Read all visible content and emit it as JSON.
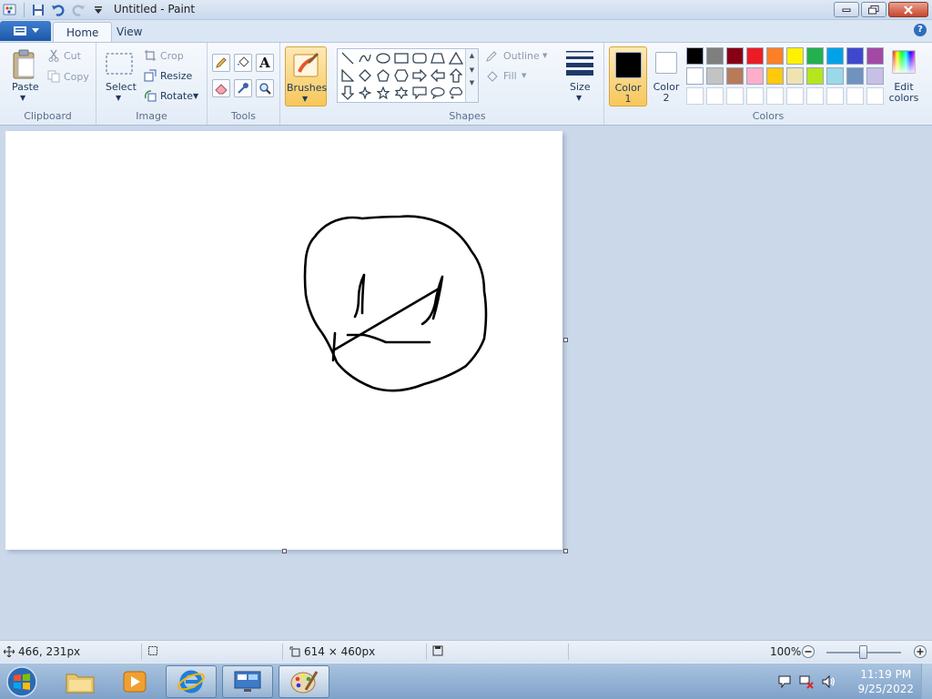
{
  "window": {
    "title": "Untitled - Paint",
    "minimize_glyph": "▭",
    "maximize_glyph": "❐",
    "close_glyph": "✕"
  },
  "tabs": [
    {
      "label": "Home",
      "active": true
    },
    {
      "label": "View",
      "active": false
    }
  ],
  "ribbon": {
    "clipboard": {
      "group_label": "Clipboard",
      "paste": "Paste",
      "cut": "Cut",
      "copy": "Copy"
    },
    "image": {
      "group_label": "Image",
      "select": "Select",
      "crop": "Crop",
      "resize": "Resize",
      "rotate": "Rotate"
    },
    "tools": {
      "group_label": "Tools",
      "text_glyph": "A"
    },
    "brushes": {
      "label": "Brushes"
    },
    "shapes": {
      "group_label": "Shapes",
      "outline": "Outline",
      "fill": "Fill"
    },
    "size": {
      "label": "Size"
    },
    "colors": {
      "group_label": "Colors",
      "color1_label": "Color",
      "color1_num": "1",
      "color2_label": "Color",
      "color2_num": "2",
      "edit_label": "Edit",
      "edit_label2": "colors",
      "color1_value": "#000000",
      "color2_value": "#ffffff",
      "palette_row1": [
        "#000000",
        "#7f7f7f",
        "#880015",
        "#ed1c24",
        "#ff7f27",
        "#fff200",
        "#22b14c",
        "#00a2e8",
        "#3f48cc",
        "#a349a4"
      ],
      "palette_row2": [
        "#ffffff",
        "#c3c3c3",
        "#b97a57",
        "#ffaec9",
        "#ffc90e",
        "#efe4b0",
        "#b5e61d",
        "#99d9ea",
        "#7092be",
        "#c8bfe7"
      ],
      "palette_row3": [
        "#ffffff",
        "#ffffff",
        "#ffffff",
        "#ffffff",
        "#ffffff",
        "#ffffff",
        "#ffffff",
        "#ffffff",
        "#ffffff",
        "#ffffff"
      ]
    }
  },
  "status": {
    "cursor_pos": "466, 231px",
    "canvas_size": "614 × 460px",
    "zoom": "100%",
    "zoom_level": 0.5
  },
  "taskbar": {
    "time": "11:19 PM",
    "date": "9/25/2022"
  }
}
